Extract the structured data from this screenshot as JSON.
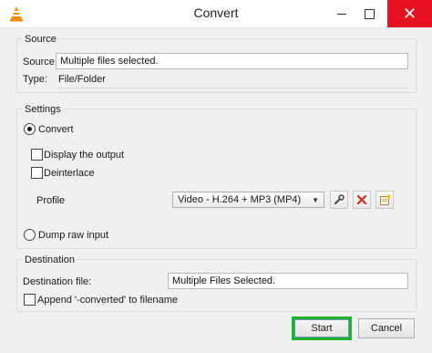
{
  "window": {
    "title": "Convert"
  },
  "source": {
    "group_title": "Source",
    "source_label": "Source:",
    "source_value": "Multiple files selected.",
    "type_label": "Type:",
    "type_value": "File/Folder"
  },
  "settings": {
    "group_title": "Settings",
    "convert_label": "Convert",
    "display_output_label": "Display the output",
    "deinterlace_label": "Deinterlace",
    "profile_label": "Profile",
    "profile_value": "Video - H.264 + MP3 (MP4)",
    "dump_raw_label": "Dump raw input"
  },
  "destination": {
    "group_title": "Destination",
    "file_label": "Destination file:",
    "file_value": "Multiple Files Selected.",
    "append_label": "Append '-converted' to filename"
  },
  "buttons": {
    "start": "Start",
    "cancel": "Cancel"
  },
  "colors": {
    "highlight": "#1fb332",
    "close": "#e81123",
    "delete": "#d9261c",
    "vlc": "#f28a00"
  }
}
